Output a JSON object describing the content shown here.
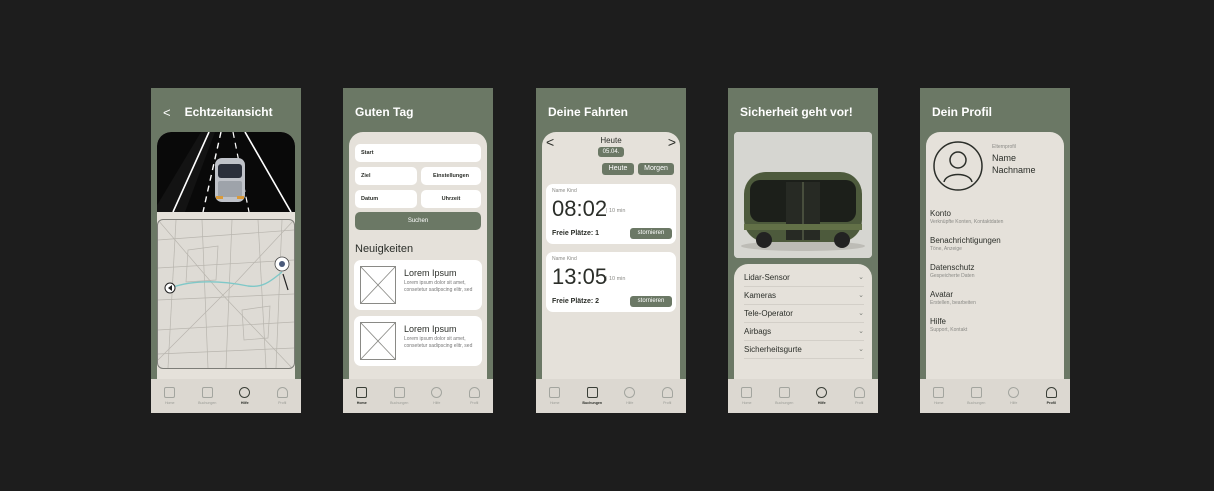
{
  "screens": {
    "s1": {
      "title": "Echtzeitansicht",
      "back": "<"
    },
    "s2": {
      "title": "Guten Tag",
      "fields": {
        "start": "Start",
        "ziel": "Ziel",
        "einstellungen": "Einstellungen",
        "datum": "Datum",
        "uhrzeit": "Uhrzeit"
      },
      "search": "Suchen",
      "news_title": "Neuigkeiten",
      "news": [
        {
          "title": "Lorem Ipsum",
          "text": "Lorem ipsum dolor sit amet, consetetur sadipscing elitr, sed"
        },
        {
          "title": "Lorem Ipsum",
          "text": "Lorem ipsum dolor sit amet, consetetur sadipscing elitr, sed"
        }
      ]
    },
    "s3": {
      "title": "Deine Fahrten",
      "day": "Heute",
      "date": "05.04.",
      "prev": "<",
      "next": ">",
      "btn_today": "Heute",
      "btn_tomorrow": "Morgen",
      "rides": [
        {
          "name": "Name Kind",
          "time": "08:02",
          "dur": "| 10 min",
          "free": "Freie Plätze: 1",
          "cancel": "stornieren"
        },
        {
          "name": "Name Kind",
          "time": "13:05",
          "dur": "| 10 min",
          "free": "Freie Plätze: 2",
          "cancel": "stornieren"
        }
      ]
    },
    "s4": {
      "title": "Sicherheit geht vor!",
      "items": [
        "Lidar-Sensor",
        "Kameras",
        "Tele-Operator",
        "Airbags",
        "Sicherheitsgurte"
      ]
    },
    "s5": {
      "title": "Dein Profil",
      "role": "Elternprofil",
      "name": "Name",
      "surname": "Nachname",
      "menu": [
        {
          "title": "Konto",
          "sub": "Verknüpfte Konten, Kontaktdaten"
        },
        {
          "title": "Benachrichtigungen",
          "sub": "Töne, Anzeige"
        },
        {
          "title": "Datenschutz",
          "sub": "Gespeicherte Daten"
        },
        {
          "title": "Avatar",
          "sub": "Erstellen, bearbeiten"
        },
        {
          "title": "Hilfe",
          "sub": "Support, Kontakt"
        }
      ]
    }
  },
  "nav": [
    "Home",
    "Buchungen",
    "Hilfe",
    "Profil"
  ],
  "colors": {
    "bg": "#1d1d1d",
    "accent": "#6b7865",
    "card": "#e5e1da"
  }
}
